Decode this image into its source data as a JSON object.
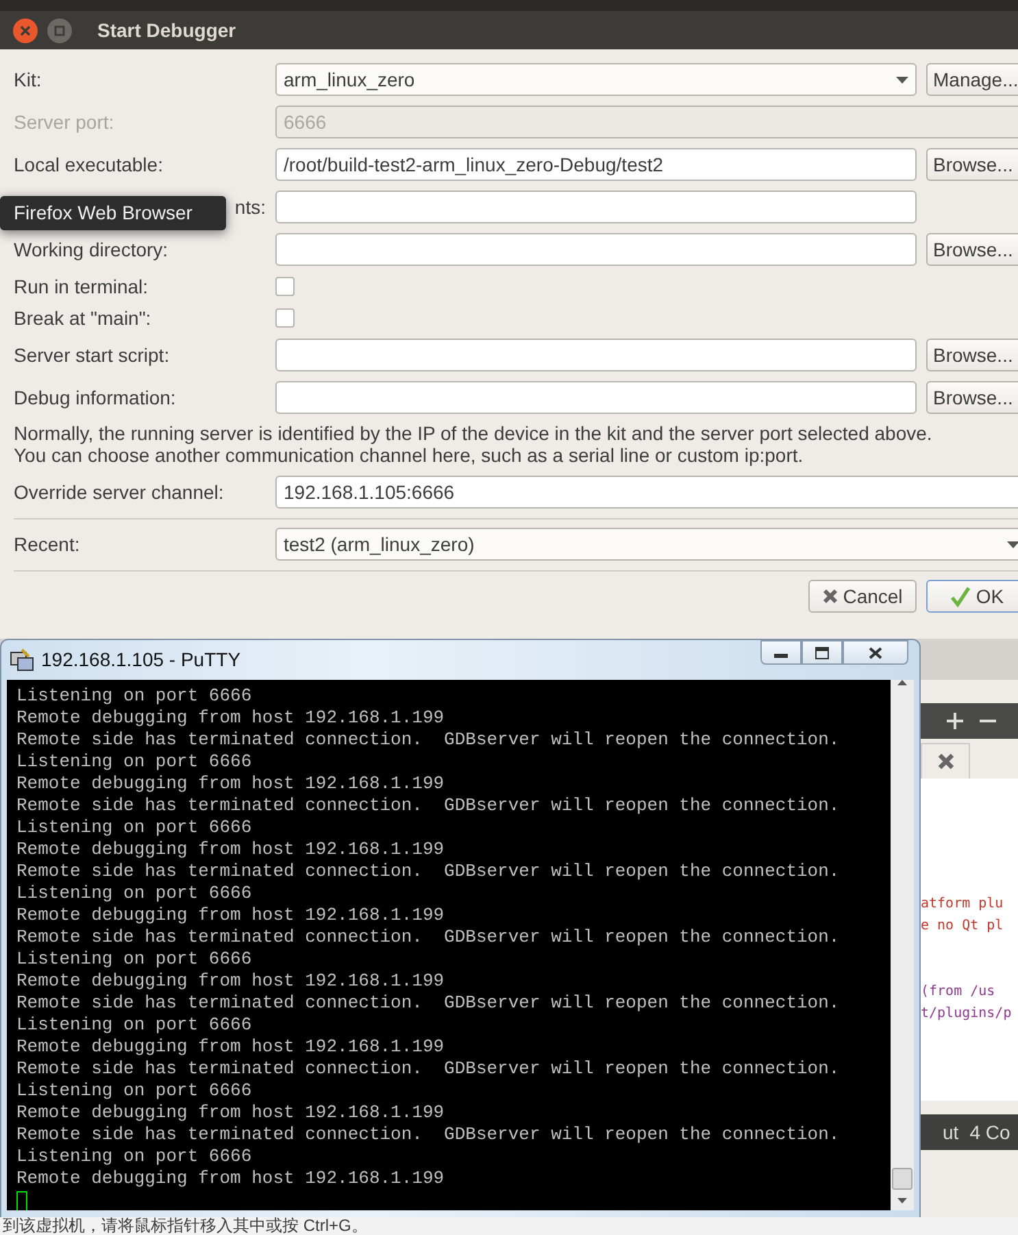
{
  "dialog": {
    "title": "Start Debugger",
    "rows": [
      {
        "kind": "combo",
        "label": "Kit:",
        "value": "arm_linux_zero",
        "button": "Manage...",
        "disabled": false
      },
      {
        "kind": "spin",
        "label": "Server port:",
        "value": "6666",
        "disabled": true
      },
      {
        "kind": "text",
        "label": "Local executable:",
        "value": "/root/build-test2-arm_linux_zero-Debug/test2",
        "button": "Browse...",
        "disabled": false
      },
      {
        "kind": "text",
        "label": "nts:",
        "disabled": false
      },
      {
        "kind": "text",
        "label": "Working directory:",
        "button": "Browse...",
        "disabled": false
      },
      {
        "kind": "check",
        "label": "Run in terminal:",
        "checked": false
      },
      {
        "kind": "check",
        "label": "Break at \"main\":",
        "checked": false
      },
      {
        "kind": "text",
        "label": "Server start script:",
        "button": "Browse...",
        "disabled": false
      },
      {
        "kind": "text",
        "label": "Debug information:",
        "button": "Browse...",
        "disabled": false
      },
      {
        "kind": "note",
        "lines": [
          "Normally, the running server is identified by the IP of the device in the kit and the server port selected above.",
          "You can choose another communication channel here, such as a serial line or custom ip:port."
        ]
      },
      {
        "kind": "wide",
        "label": "Override server channel:",
        "value": "192.168.1.105:6666",
        "disabled": false
      },
      {
        "kind": "separator"
      },
      {
        "kind": "combo",
        "label": "Recent:",
        "value": "test2  (arm_linux_zero)",
        "disabled": false
      },
      {
        "kind": "separator"
      }
    ],
    "buttons": [
      {
        "label": "Cancel",
        "kind": "cancel",
        "default": false
      },
      {
        "label": "OK",
        "kind": "ok",
        "default": true
      }
    ]
  },
  "tooltip": {
    "text": "Firefox Web Browser"
  },
  "terminal": {
    "title": "192.168.1.105 - PuTTY",
    "lines": [
      "Listening on port 6666",
      "Remote debugging from host 192.168.1.199",
      "Remote side has terminated connection.  GDBserver will reopen the connection.",
      "Listening on port 6666",
      "Remote debugging from host 192.168.1.199",
      "Remote side has terminated connection.  GDBserver will reopen the connection.",
      "Listening on port 6666",
      "Remote debugging from host 192.168.1.199",
      "Remote side has terminated connection.  GDBserver will reopen the connection.",
      "Listening on port 6666",
      "Remote debugging from host 192.168.1.199",
      "Remote side has terminated connection.  GDBserver will reopen the connection.",
      "Listening on port 6666",
      "Remote debugging from host 192.168.1.199",
      "Remote side has terminated connection.  GDBserver will reopen the connection.",
      "Listening on port 6666",
      "Remote debugging from host 192.168.1.199",
      "Remote side has terminated connection.  GDBserver will reopen the connection.",
      "Listening on port 6666",
      "Remote debugging from host 192.168.1.199",
      "Remote side has terminated connection.  GDBserver will reopen the connection.",
      "Listening on port 6666",
      "Remote debugging from host 192.168.1.199"
    ]
  },
  "background_window": {
    "output": [
      {
        "text": "atform plu",
        "color": "#c0392b"
      },
      {
        "text": "e no Qt pl",
        "color": "#c0392b"
      },
      {
        "text": "(from /us",
        "color": "#8e3a8e"
      },
      {
        "text": "t/plugins/p",
        "color": "#8e3a8e"
      }
    ],
    "pane_tabs": [
      "ut",
      "4 Co"
    ]
  },
  "status_strip": {
    "text": "到该虚拟机，请将鼠标指针移入其中或按 Ctrl+G。"
  }
}
